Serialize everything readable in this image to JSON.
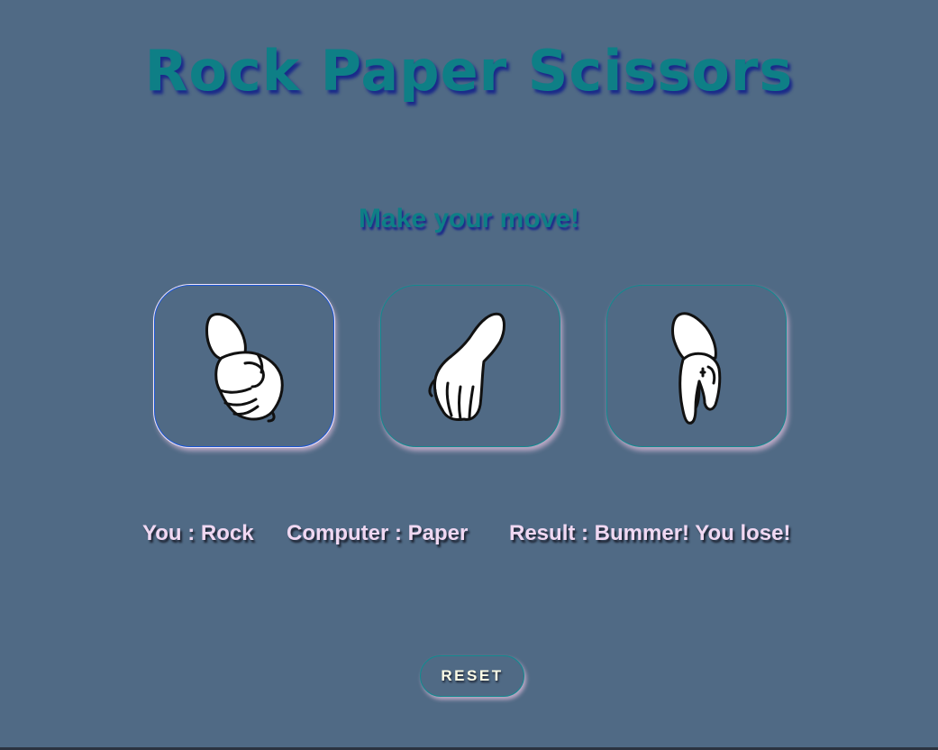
{
  "title": "Rock Paper Scissors",
  "subtitle": "Make your move!",
  "choices": [
    {
      "name": "Rock",
      "icon": "rock-hand-icon",
      "selected": true
    },
    {
      "name": "Paper",
      "icon": "paper-hand-icon",
      "selected": false
    },
    {
      "name": "Scissors",
      "icon": "scissors-hand-icon",
      "selected": false
    }
  ],
  "score": {
    "you": "You : Rock",
    "computer": "Computer : Paper",
    "result": "Result : Bummer! You lose!"
  },
  "reset_label": "RESET",
  "colors": {
    "background": "#506a85",
    "accent": "#0e7f86",
    "text": "#f0d8f2",
    "selected_border": "#1a56d6"
  }
}
